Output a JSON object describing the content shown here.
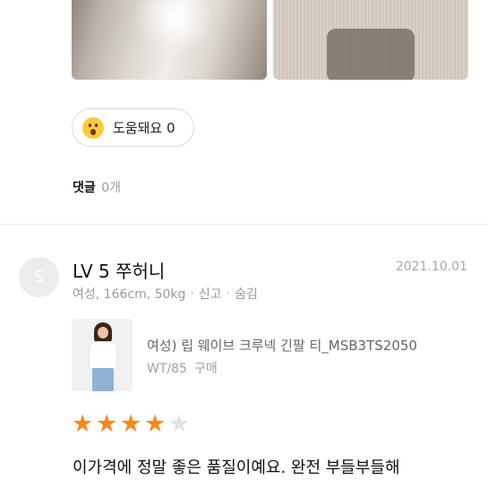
{
  "photos": [
    {
      "name": "review-photo-1"
    },
    {
      "name": "review-photo-2"
    }
  ],
  "helpful": {
    "icon": "surprised-face-emoji-icon",
    "label": "도움돼요 0"
  },
  "comments": {
    "title": "댓글",
    "count": "0개"
  },
  "review": {
    "avatar_letter": "S",
    "user": "LV 5 쭈허니",
    "date": "2021.10.01",
    "profile": "여성, 166cm, 50kg",
    "dot": "·",
    "report_label": "신고",
    "hide_label": "숨김",
    "product": {
      "name": "여성) 립 웨이브 크루넥 긴팔 티_MSB3TS2050",
      "option": "WT/85",
      "option_suffix": "구매"
    },
    "rating": 4,
    "rating_max": 5,
    "text": "이가격에 정말 좋은 품질이예요. 완전 부들부들해"
  },
  "colors": {
    "star_on": "#f5891f",
    "star_off": "#e2e2e2",
    "emoji": "#ffc83d"
  }
}
